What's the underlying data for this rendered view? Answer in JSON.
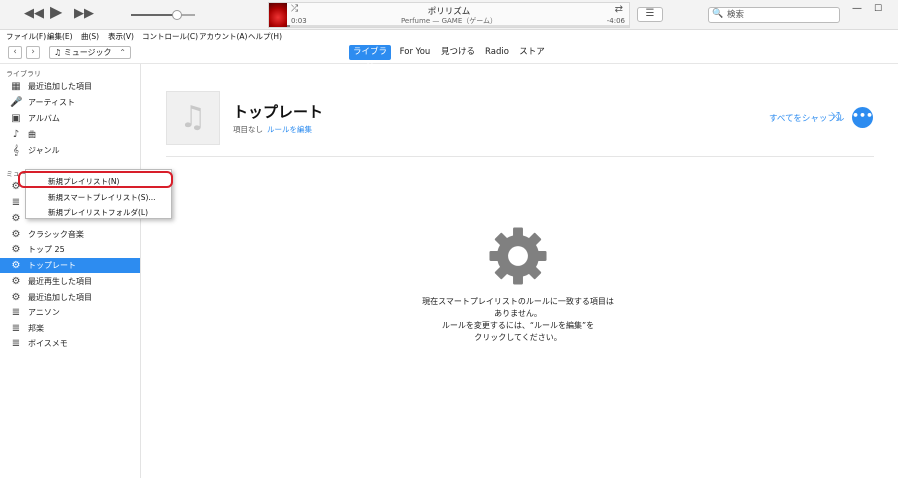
{
  "player": {
    "prev_icon": "rewind-icon",
    "play_icon": "play-icon",
    "next_icon": "fast-forward-icon",
    "now_playing": {
      "title": "ポリリズム",
      "subtitle": "Perfume — GAME（ゲーム）",
      "elapsed": "0:03",
      "remaining": "-4:06",
      "progress_fraction": 0.01
    },
    "volume_fraction": 0.72,
    "search_placeholder": "検索"
  },
  "menubar": [
    "ファイル(F)",
    "編集(E)",
    "曲(S)",
    "表示(V)",
    "コントロール(C)",
    "アカウント(A)",
    "ヘルプ(H)"
  ],
  "nav": {
    "media_kind": "ミュージック",
    "tabs": [
      "ライブラリ",
      "For You",
      "見つける",
      "Radio",
      "ストア"
    ],
    "active_tab_index": 0
  },
  "sidebar": {
    "library_header": "ライブラリ",
    "library_items": [
      {
        "label": "最近追加した項目",
        "icon": "calendar-grid-icon"
      },
      {
        "label": "アーティスト",
        "icon": "microphone-icon"
      },
      {
        "label": "アルバム",
        "icon": "album-icon"
      },
      {
        "label": "曲",
        "icon": "music-note-icon"
      },
      {
        "label": "ジャンル",
        "icon": "genre-icon"
      }
    ],
    "playlists_header": "ミュー",
    "playlist_items": [
      {
        "label": "クラシック音楽",
        "icon": "gear-icon"
      },
      {
        "label": "トップ 25",
        "icon": "gear-icon"
      },
      {
        "label": "トップレート",
        "icon": "gear-icon",
        "selected": true
      },
      {
        "label": "最近再生した項目",
        "icon": "gear-icon"
      },
      {
        "label": "最近追加した項目",
        "icon": "gear-icon"
      },
      {
        "label": "アニソン",
        "icon": "playlist-icon"
      },
      {
        "label": "邦楽",
        "icon": "playlist-icon"
      },
      {
        "label": "ボイスメモ",
        "icon": "playlist-icon"
      }
    ]
  },
  "context_menu": {
    "items": [
      "新規プレイリスト(N)",
      "新規スマートプレイリスト(S)...",
      "新規プレイリストフォルダ(L)"
    ],
    "highlighted_index": 0,
    "highlight_color": "#d81e2a"
  },
  "main": {
    "title": "トップレート",
    "meta": "項目なし",
    "edit_rules": "ルールを編集",
    "shuffle_all": "すべてをシャッフル",
    "more_label": "•••",
    "empty_lines": [
      "現在スマートプレイリストのルールに一致する項目は",
      "ありません。",
      "ルールを変更するには、“ルールを編集”を",
      "クリックしてください。"
    ]
  },
  "colors": {
    "accent": "#2d8cf0",
    "highlight_ring": "#d81e2a"
  }
}
